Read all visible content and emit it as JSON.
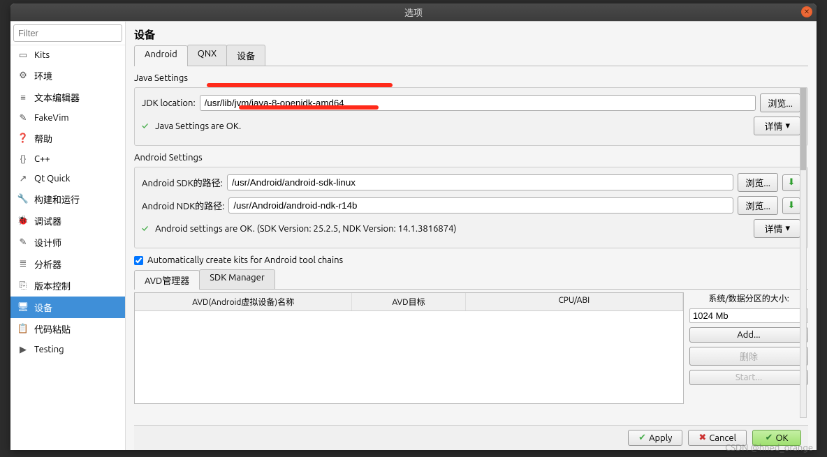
{
  "window": {
    "title": "选项"
  },
  "filter": {
    "placeholder": "Filter"
  },
  "categories": [
    {
      "icon": "kits",
      "label": "Kits"
    },
    {
      "icon": "env",
      "label": "环境"
    },
    {
      "icon": "text",
      "label": "文本编辑器"
    },
    {
      "icon": "vim",
      "label": "FakeVim"
    },
    {
      "icon": "help",
      "label": "帮助"
    },
    {
      "icon": "cpp",
      "label": "C++"
    },
    {
      "icon": "qt",
      "label": "Qt Quick"
    },
    {
      "icon": "build",
      "label": "构建和运行"
    },
    {
      "icon": "debug",
      "label": "调试器"
    },
    {
      "icon": "design",
      "label": "设计师"
    },
    {
      "icon": "analyze",
      "label": "分析器"
    },
    {
      "icon": "vcs",
      "label": "版本控制"
    },
    {
      "icon": "device",
      "label": "设备",
      "selected": true
    },
    {
      "icon": "paste",
      "label": "代码粘贴"
    },
    {
      "icon": "test",
      "label": "Testing"
    }
  ],
  "main": {
    "heading": "设备",
    "tabs": [
      "Android",
      "QNX",
      "设备"
    ],
    "activeTab": 0
  },
  "java": {
    "section": "Java Settings",
    "jdkLabel": "JDK location:",
    "jdkValue": "/usr/lib/jvm/java-8-openjdk-amd64",
    "browse": "浏览...",
    "status": "Java Settings are OK.",
    "details": "详情"
  },
  "android": {
    "section": "Android Settings",
    "sdkLabel": "Android SDK的路径:",
    "sdkValue": "/usr/Android/android-sdk-linux",
    "ndkLabel": "Android NDK的路径:",
    "ndkValue": "/usr/Android/android-ndk-r14b",
    "browse": "浏览...",
    "status": "Android settings are OK. (SDK Version: 25.2.5, NDK Version: 14.1.3816874)",
    "details": "详情"
  },
  "autoKits": {
    "label": "Automatically create kits for Android tool chains",
    "checked": true
  },
  "managers": {
    "tabs": [
      "AVD管理器",
      "SDK Manager"
    ],
    "active": 0
  },
  "avd": {
    "columns": [
      "AVD(Android虚拟设备)名称",
      "AVD目标",
      "CPU/ABI"
    ],
    "sideHeader": "系统/数据分区的大小:",
    "sizeValue": "1024 Mb",
    "add": "Add...",
    "delete": "删除",
    "start": "Start..."
  },
  "footer": {
    "apply": "Apply",
    "cancel": "Cancel",
    "ok": "OK"
  },
  "watermark": "CSDN @hned_orange"
}
